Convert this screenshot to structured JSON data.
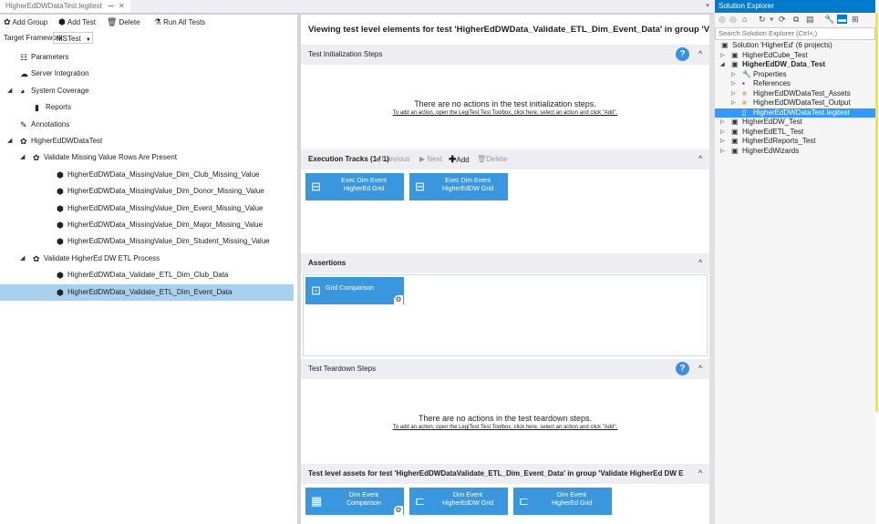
{
  "tabstrip": {
    "doc_tab_label": "HigherEdDWDataTest.legitest",
    "pin_icon": "⊸",
    "close_icon": "✕",
    "dropdown_icon": "▾"
  },
  "toolbar": {
    "add_group": "Add Group",
    "add_test": "Add Test",
    "delete": "Delete",
    "run_all": "Run All Tests"
  },
  "framework": {
    "label": "Target Framework:",
    "value": "MSTest"
  },
  "tree": [
    {
      "label": "Parameters",
      "indent": 1,
      "arrow": "",
      "icon": "parameters-icon"
    },
    {
      "label": "Server Integration",
      "indent": 1,
      "arrow": "",
      "icon": "cloud-icon"
    },
    {
      "label": "System Coverage",
      "indent": 0,
      "arrow": "◢",
      "icon": "coverage-icon"
    },
    {
      "label": "Reports",
      "indent": 2,
      "arrow": "",
      "icon": "reports-icon"
    },
    {
      "label": "Annotations",
      "indent": 1,
      "arrow": "",
      "icon": "annotations-icon"
    },
    {
      "label": "HigherEdDWDataTest",
      "indent": 0,
      "arrow": "◢",
      "icon": "group-icon"
    },
    {
      "label": "Validate Missing Value Rows Are Present",
      "indent": 1,
      "arrow": "◢",
      "icon": "group-icon"
    },
    {
      "label": "HigherEdDWData_MissingValue_Dim_Club_Missing_Value",
      "indent": 2,
      "arrow": "",
      "icon": "test-icon"
    },
    {
      "label": "HigherEdDWData_MissingValue_Dim_Donor_Missing_Value",
      "indent": 2,
      "arrow": "",
      "icon": "test-icon"
    },
    {
      "label": "HigherEdDWData_MissingValue_Dim_Event_Missing_Value",
      "indent": 2,
      "arrow": "",
      "icon": "test-icon"
    },
    {
      "label": "HigherEdDWData_MissingValue_Dim_Major_Missing_Value",
      "indent": 2,
      "arrow": "",
      "icon": "test-icon"
    },
    {
      "label": "HigherEdDWData_MissingValue_Dim_Student_Missing_Value",
      "indent": 2,
      "arrow": "",
      "icon": "test-icon"
    },
    {
      "label": "Validate HigherEd DW ETL Process",
      "indent": 1,
      "arrow": "◢",
      "icon": "group-icon"
    },
    {
      "label": "HigherEdDWData_Validate_ETL_Dim_Club_Data",
      "indent": 2,
      "arrow": "",
      "icon": "test-icon"
    },
    {
      "label": "HigherEdDWData_Validate_ETL_Dim_Event_Data",
      "indent": 2,
      "arrow": "",
      "icon": "test-icon",
      "selected": true
    }
  ],
  "center": {
    "title": "Viewing test level elements for test 'HigherEdDWData_Validate_ETL_Dim_Event_Data' in group 'Va...",
    "init_header": "Test Initialization Steps",
    "init_empty_line1": "There are no actions in the test initialization steps.",
    "init_empty_line2": "To add an action, open the LegiTest Test Toolbox, click here, select an action and click \"Add\".",
    "exec_header": "Execution Tracks (1 / 1)",
    "exec_previous": "Previous",
    "exec_next": "Next",
    "exec_add": "Add",
    "exec_delete": "Delete",
    "exec_tiles": [
      {
        "line1": "Exec Dim Event",
        "line2": "HigherEd Grid"
      },
      {
        "line1": "Exec Dim Event",
        "line2": "HigherEdDW Grid"
      }
    ],
    "assert_header": "Assertions",
    "assert_tiles": [
      {
        "line1": "Grid Comparison",
        "line2": ""
      }
    ],
    "teardown_header": "Test Teardown Steps",
    "teardown_empty_line1": "There are no actions in the test teardown steps.",
    "teardown_empty_line2": "To add an action, open the LegiTest Test Toolbox, click here, select an action and click \"Add\".",
    "assets_header": "Test level assets for test 'HigherEdDWDataValidate_ETL_Dim_Event_Data' in group 'Validate HigherEd DW E",
    "asset_tiles": [
      {
        "line1": "Dim Event",
        "line2": "Comparison"
      },
      {
        "line1": "Dim Event",
        "line2": "HigherEdDW Grid"
      },
      {
        "line1": "Dim Event",
        "line2": "HigherEd Grid"
      }
    ],
    "help_label": "?",
    "chevron_up": "^"
  },
  "solution": {
    "title": "Solution Explorer",
    "search_placeholder": "Search Solution Explorer (Ctrl+;)",
    "items": [
      {
        "label": "Solution 'HigherEd' (6 projects)",
        "indent": 0,
        "arrow": "",
        "bold": false
      },
      {
        "label": "HigherEdCube_Test",
        "indent": 1,
        "arrow": "▷",
        "bold": false
      },
      {
        "label": "HigherEdDW_Data_Test",
        "indent": 1,
        "arrow": "◢",
        "bold": true
      },
      {
        "label": "Properties",
        "indent": 2,
        "arrow": "▷",
        "bold": false
      },
      {
        "label": "References",
        "indent": 2,
        "arrow": "▷",
        "bold": false
      },
      {
        "label": "HigherEdDWDataTest_Assets",
        "indent": 2,
        "arrow": "▷",
        "bold": false
      },
      {
        "label": "HigherEdDWDataTest_Output",
        "indent": 2,
        "arrow": "▷",
        "bold": false
      },
      {
        "label": "HigherEdDWDataTest.legitest",
        "indent": 2,
        "arrow": "",
        "bold": false,
        "selected": true
      },
      {
        "label": "HigherEdDW_Test",
        "indent": 1,
        "arrow": "▷",
        "bold": false
      },
      {
        "label": "HigherEdETL_Test",
        "indent": 1,
        "arrow": "▷",
        "bold": false
      },
      {
        "label": "HigherEdReports_Test",
        "indent": 1,
        "arrow": "▷",
        "bold": false
      },
      {
        "label": "HigherEdWizards",
        "indent": 1,
        "arrow": "▷",
        "bold": false
      }
    ]
  },
  "colors": {
    "accent": "#007acc",
    "tile": "#3a96dd",
    "selection": "#a9d1ef"
  }
}
